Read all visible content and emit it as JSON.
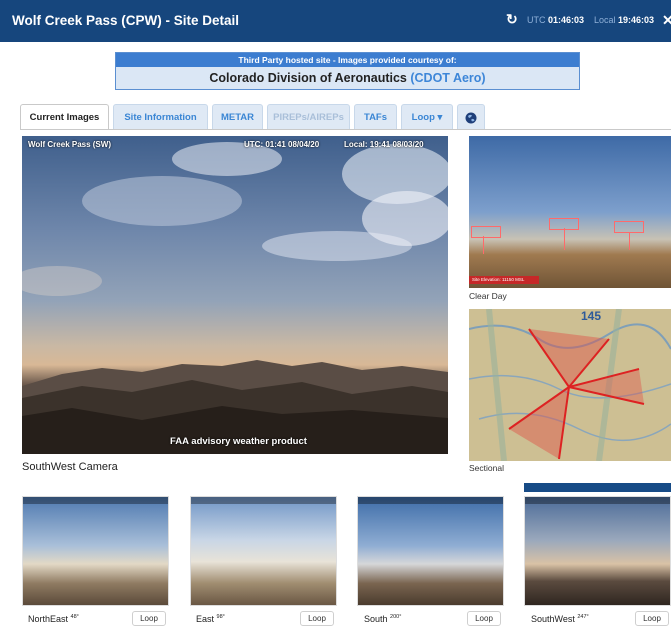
{
  "header": {
    "title": "Wolf Creek Pass (CPW) - Site Detail",
    "refresh_icon": "refresh-icon",
    "utc_label": "UTC",
    "utc_time": "01:46:03",
    "local_label": "Local",
    "local_time": "19:46:03",
    "close_icon": "close-icon",
    "bg_color": "#16467d"
  },
  "banner": {
    "line1": "Third Party hosted site - Images provided courtesy of:",
    "agency_name": "Colorado Division of Aeronautics",
    "agency_abbr": "(CDOT Aero)"
  },
  "tabs": [
    {
      "label": "Current Images",
      "state": "active"
    },
    {
      "label": "Site Information",
      "state": "normal"
    },
    {
      "label": "METAR",
      "state": "normal"
    },
    {
      "label": "PIREPs/AIREPs",
      "state": "disabled"
    },
    {
      "label": "TAFs",
      "state": "normal"
    },
    {
      "label": "Loop",
      "state": "dropdown"
    },
    {
      "label": "",
      "icon": "globe-icon",
      "state": "normal"
    }
  ],
  "main_camera": {
    "overlay_site": "Wolf Creek Pass (SW)",
    "overlay_utc": "UTC: 01:41 08/04/20",
    "overlay_local": "Local: 19:41 08/03/20",
    "watermark": "FAA advisory weather product",
    "caption": "SouthWest Camera"
  },
  "side_images": [
    {
      "caption": "Clear Day",
      "elevation_label": "Site Elevation: 11150 MSL"
    },
    {
      "caption": "Sectional",
      "map_number": "145"
    }
  ],
  "thumbnails": [
    {
      "label": "NorthEast",
      "deg": "48°",
      "loop": "Loop"
    },
    {
      "label": "East",
      "deg": "98°",
      "loop": "Loop"
    },
    {
      "label": "South",
      "deg": "200°",
      "loop": "Loop"
    },
    {
      "label": "SouthWest",
      "deg": "247°",
      "loop": "Loop"
    }
  ]
}
